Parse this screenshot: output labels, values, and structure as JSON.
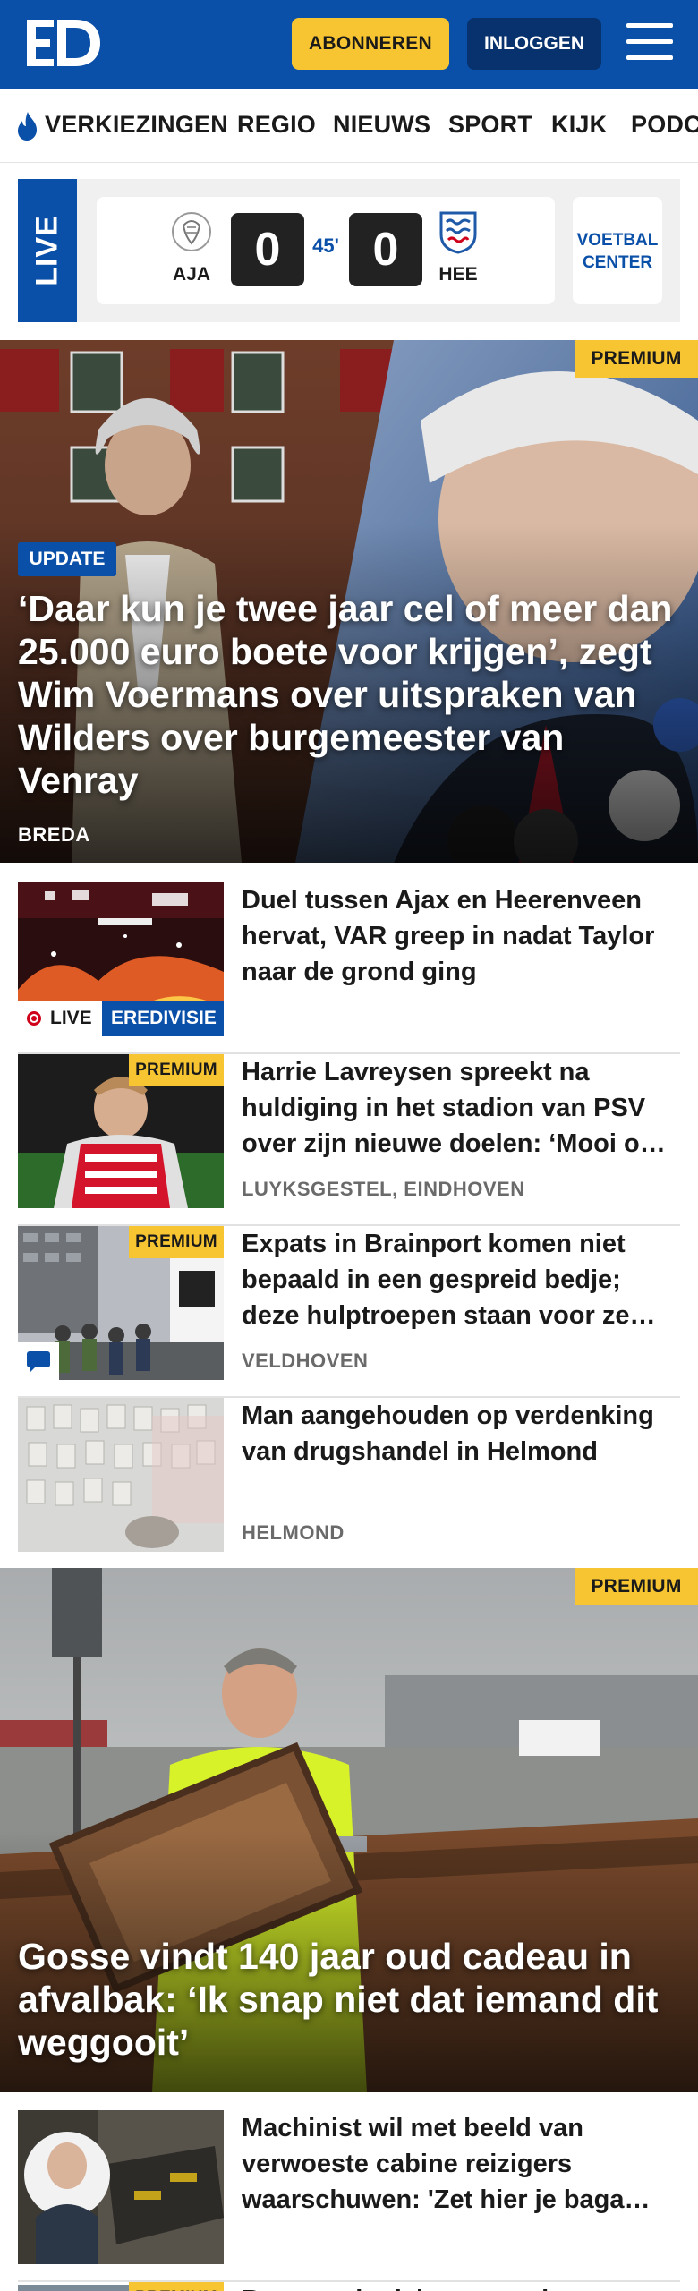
{
  "header": {
    "logo_text": "ED",
    "subscribe_label": "ABONNEREN",
    "login_label": "INLOGGEN",
    "menu_icon": "hamburger-icon",
    "brand_color": "#0a4fa8",
    "accent_color": "#f7c531"
  },
  "nav": {
    "items": [
      {
        "label": "VERKIEZINGEN",
        "icon": "flame-icon"
      },
      {
        "label": "REGIO"
      },
      {
        "label": "NIEUWS"
      },
      {
        "label": "SPORT"
      },
      {
        "label": "KIJK"
      },
      {
        "label": "PODC"
      }
    ]
  },
  "live": {
    "label": "LIVE",
    "home_team": "AJA",
    "home_score": "0",
    "away_team": "HEE",
    "away_score": "0",
    "minute": "45'",
    "voetbal_center_label": "VOETBAL CENTER"
  },
  "hero": {
    "premium_label": "PREMIUM",
    "update_label": "UPDATE",
    "title": "‘Daar kun je twee jaar cel of meer dan 25.000 euro boete voor krijgen’, zegt Wim Voermans over uitspraken van Wilders over burgemeester van Venray",
    "location": "BREDA"
  },
  "articles": [
    {
      "title": "Duel tussen Ajax en Heerenveen hervat, VAR greep in nadat Taylor naar de grond ging",
      "live_label": "LIVE",
      "category": "EREDIVISIE",
      "location": ""
    },
    {
      "premium_label": "PREMIUM",
      "title": "Harrie Lavreysen spreekt na huldiging in het stadion van PSV over zijn nieuwe doelen: ‘Mooi o…",
      "location": "LUYKSGESTEL, EINDHOVEN"
    },
    {
      "premium_label": "PREMIUM",
      "title": "Expats in Brainport komen niet bepaald in een gespreid bedje; deze hulptroepen staan voor ze…",
      "location": "VELDHOVEN",
      "comment_icon": "comment-icon"
    },
    {
      "title": "Man aangehouden op verdenking van drugshandel in Helmond",
      "location": "HELMOND"
    }
  ],
  "hero2": {
    "premium_label": "PREMIUM",
    "title": "Gosse vindt 140 jaar oud cadeau in afvalbak: ‘Ik snap niet dat iemand dit weggooit’"
  },
  "articles2": [
    {
      "title": "Machinist wil met beeld van verwoeste cabine reizigers waarschuwen: 'Zet hier je baga…"
    },
    {
      "premium_label": "PREMIUM",
      "title": "Boom trekt dak van woning"
    }
  ]
}
